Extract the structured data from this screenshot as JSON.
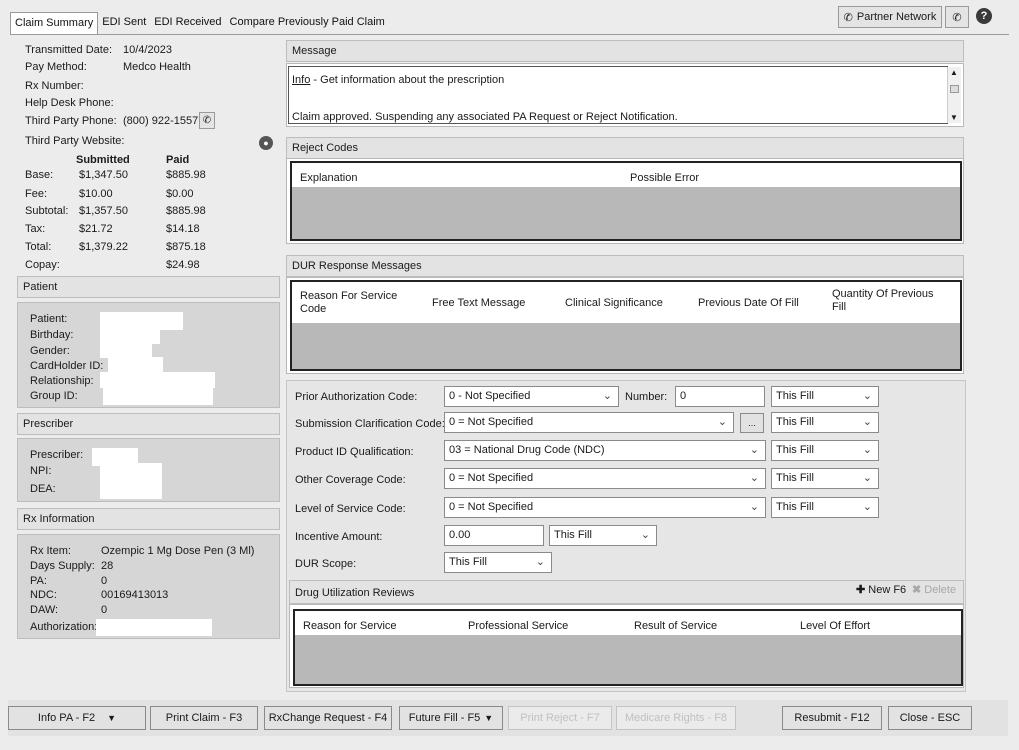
{
  "tabs": [
    "Claim Summary",
    "EDI Sent",
    "EDI Received",
    "Compare Previously Paid Claim"
  ],
  "top": {
    "partner_network": "Partner Network"
  },
  "claim": {
    "transmitted_label": "Transmitted Date:",
    "transmitted_value": "10/4/2023",
    "pay_method_label": "Pay Method:",
    "pay_method_value": "Medco Health",
    "rx_number_label": "Rx Number:",
    "help_desk_label": "Help Desk Phone:",
    "third_party_phone_label": "Third Party Phone:",
    "third_party_phone_value": "(800) 922-1557",
    "third_party_website_label": "Third Party Website:"
  },
  "amounts": {
    "submitted_header": "Submitted",
    "paid_header": "Paid",
    "rows": [
      {
        "label": "Base:",
        "submitted": "$1,347.50",
        "paid": "$885.98"
      },
      {
        "label": "Fee:",
        "submitted": "$10.00",
        "paid": "$0.00"
      },
      {
        "label": "Subtotal:",
        "submitted": "$1,357.50",
        "paid": "$885.98"
      },
      {
        "label": "Tax:",
        "submitted": "$21.72",
        "paid": "$14.18"
      },
      {
        "label": "Total:",
        "submitted": "$1,379.22",
        "paid": "$875.18"
      },
      {
        "label": "Copay:",
        "submitted": "",
        "paid": "$24.98"
      }
    ]
  },
  "patient": {
    "title": "Patient",
    "fields": [
      "Patient:",
      "Birthday:",
      "Gender:",
      "CardHolder ID:",
      "Relationship:",
      "Group ID:"
    ]
  },
  "prescriber": {
    "title": "Prescriber",
    "fields": [
      "Prescriber:",
      "NPI:",
      "DEA:"
    ]
  },
  "rx_info": {
    "title": "Rx Information",
    "rows": [
      {
        "label": "Rx Item:",
        "value": "Ozempic 1 Mg Dose Pen (3 Ml)"
      },
      {
        "label": "Days Supply:",
        "value": "28"
      },
      {
        "label": "PA:",
        "value": "0"
      },
      {
        "label": "NDC:",
        "value": "00169413013"
      },
      {
        "label": "DAW:",
        "value": "0"
      },
      {
        "label": "Authorization:",
        "value": ""
      }
    ]
  },
  "message": {
    "title": "Message",
    "link": "Info",
    "line1": " - Get information about the prescription",
    "line2": "Claim approved. Suspending any associated PA Request or Reject Notification."
  },
  "reject_codes": {
    "title": "Reject Codes",
    "columns": [
      "Explanation",
      "Possible Error"
    ]
  },
  "dur": {
    "title": "DUR Response Messages",
    "columns": [
      "Reason For Service Code",
      "Free Text Message",
      "Clinical Significance",
      "Previous Date Of Fill",
      "Quantity Of Previous Fill"
    ]
  },
  "form": {
    "prior_auth_label": "Prior Authorization Code:",
    "prior_auth_value": "0 - Not Specified",
    "number_label": "Number:",
    "number_value": "0",
    "submission_label": "Submission Clarification Code:",
    "submission_value": "0 = Not Specified",
    "submission_button": "...",
    "product_label": "Product ID Qualification:",
    "product_value": "03 = National Drug Code (NDC)",
    "other_cov_label": "Other Coverage Code:",
    "other_cov_value": "0 = Not Specified",
    "level_label": "Level of Service Code:",
    "level_value": "0 = Not Specified",
    "incentive_label": "Incentive Amount:",
    "incentive_value": "0.00",
    "dur_scope_label": "DUR Scope:",
    "dur_scope_value": "This Fill",
    "fill_value": "This Fill"
  },
  "dur_reviews": {
    "title": "Drug Utilization Reviews",
    "new": "New F6",
    "delete": "Delete",
    "columns": [
      "Reason for Service",
      "Professional Service",
      "Result of Service",
      "Level Of Effort"
    ]
  },
  "buttons": {
    "info_pa": "Info PA - F2",
    "print_claim": "Print Claim - F3",
    "rxchange": "RxChange Request - F4",
    "future_fill": "Future Fill - F5",
    "print_reject": "Print Reject - F7",
    "medicare_rights": "Medicare Rights - F8",
    "resubmit": "Resubmit - F12",
    "close": "Close - ESC"
  }
}
